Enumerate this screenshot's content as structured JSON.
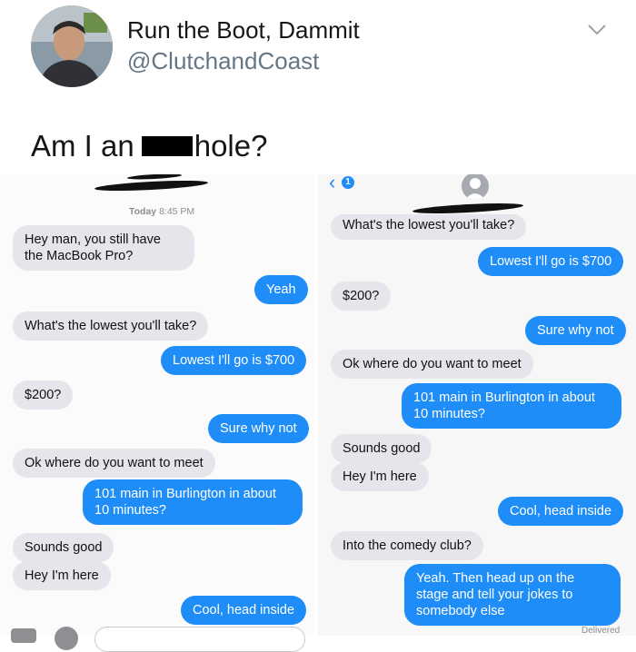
{
  "tweet": {
    "author_name": "Run the Boot, Dammit",
    "handle": "@ClutchandCoast",
    "text_before_censor": "Am I an",
    "text_after_censor": "hole?",
    "menu_icon": "chevron-down-icon"
  },
  "left_screenshot": {
    "timestamp_prefix": "Today",
    "timestamp_time": "8:45 PM",
    "messages": [
      {
        "side": "in",
        "text": "Hey man, you still have the MacBook Pro?"
      },
      {
        "side": "out",
        "text": "Yeah"
      },
      {
        "side": "in",
        "text": "What's the lowest you'll take?"
      },
      {
        "side": "out",
        "text": "Lowest I'll go is $700"
      },
      {
        "side": "in",
        "text": "$200?"
      },
      {
        "side": "out",
        "text": "Sure why not"
      },
      {
        "side": "in",
        "text": "Ok where do you want to meet"
      },
      {
        "side": "out",
        "text": "101 main in Burlington in about 10 minutes?"
      },
      {
        "side": "in",
        "text": "Sounds good"
      },
      {
        "side": "in",
        "text": "Hey I'm here"
      },
      {
        "side": "out",
        "text": "Cool, head inside"
      }
    ]
  },
  "right_screenshot": {
    "back_badge": "1",
    "messages": [
      {
        "side": "in",
        "text": "What's the lowest you'll take?"
      },
      {
        "side": "out",
        "text": "Lowest I'll go is $700"
      },
      {
        "side": "in",
        "text": "$200?"
      },
      {
        "side": "out",
        "text": "Sure why not"
      },
      {
        "side": "in",
        "text": "Ok where do you want to meet"
      },
      {
        "side": "out",
        "text": "101 main in Burlington in about 10 minutes?"
      },
      {
        "side": "in",
        "text": "Sounds good"
      },
      {
        "side": "in",
        "text": "Hey I'm here"
      },
      {
        "side": "out",
        "text": "Cool, head inside"
      },
      {
        "side": "in",
        "text": "Into the comedy club?"
      },
      {
        "side": "out",
        "text": "Yeah. Then head up on the stage and tell your jokes to somebody else"
      }
    ],
    "delivered_label": "Delivered"
  },
  "colors": {
    "imessage_blue": "#1e8df7",
    "incoming_gray": "#e6e5eb",
    "handle_gray": "#657786"
  }
}
